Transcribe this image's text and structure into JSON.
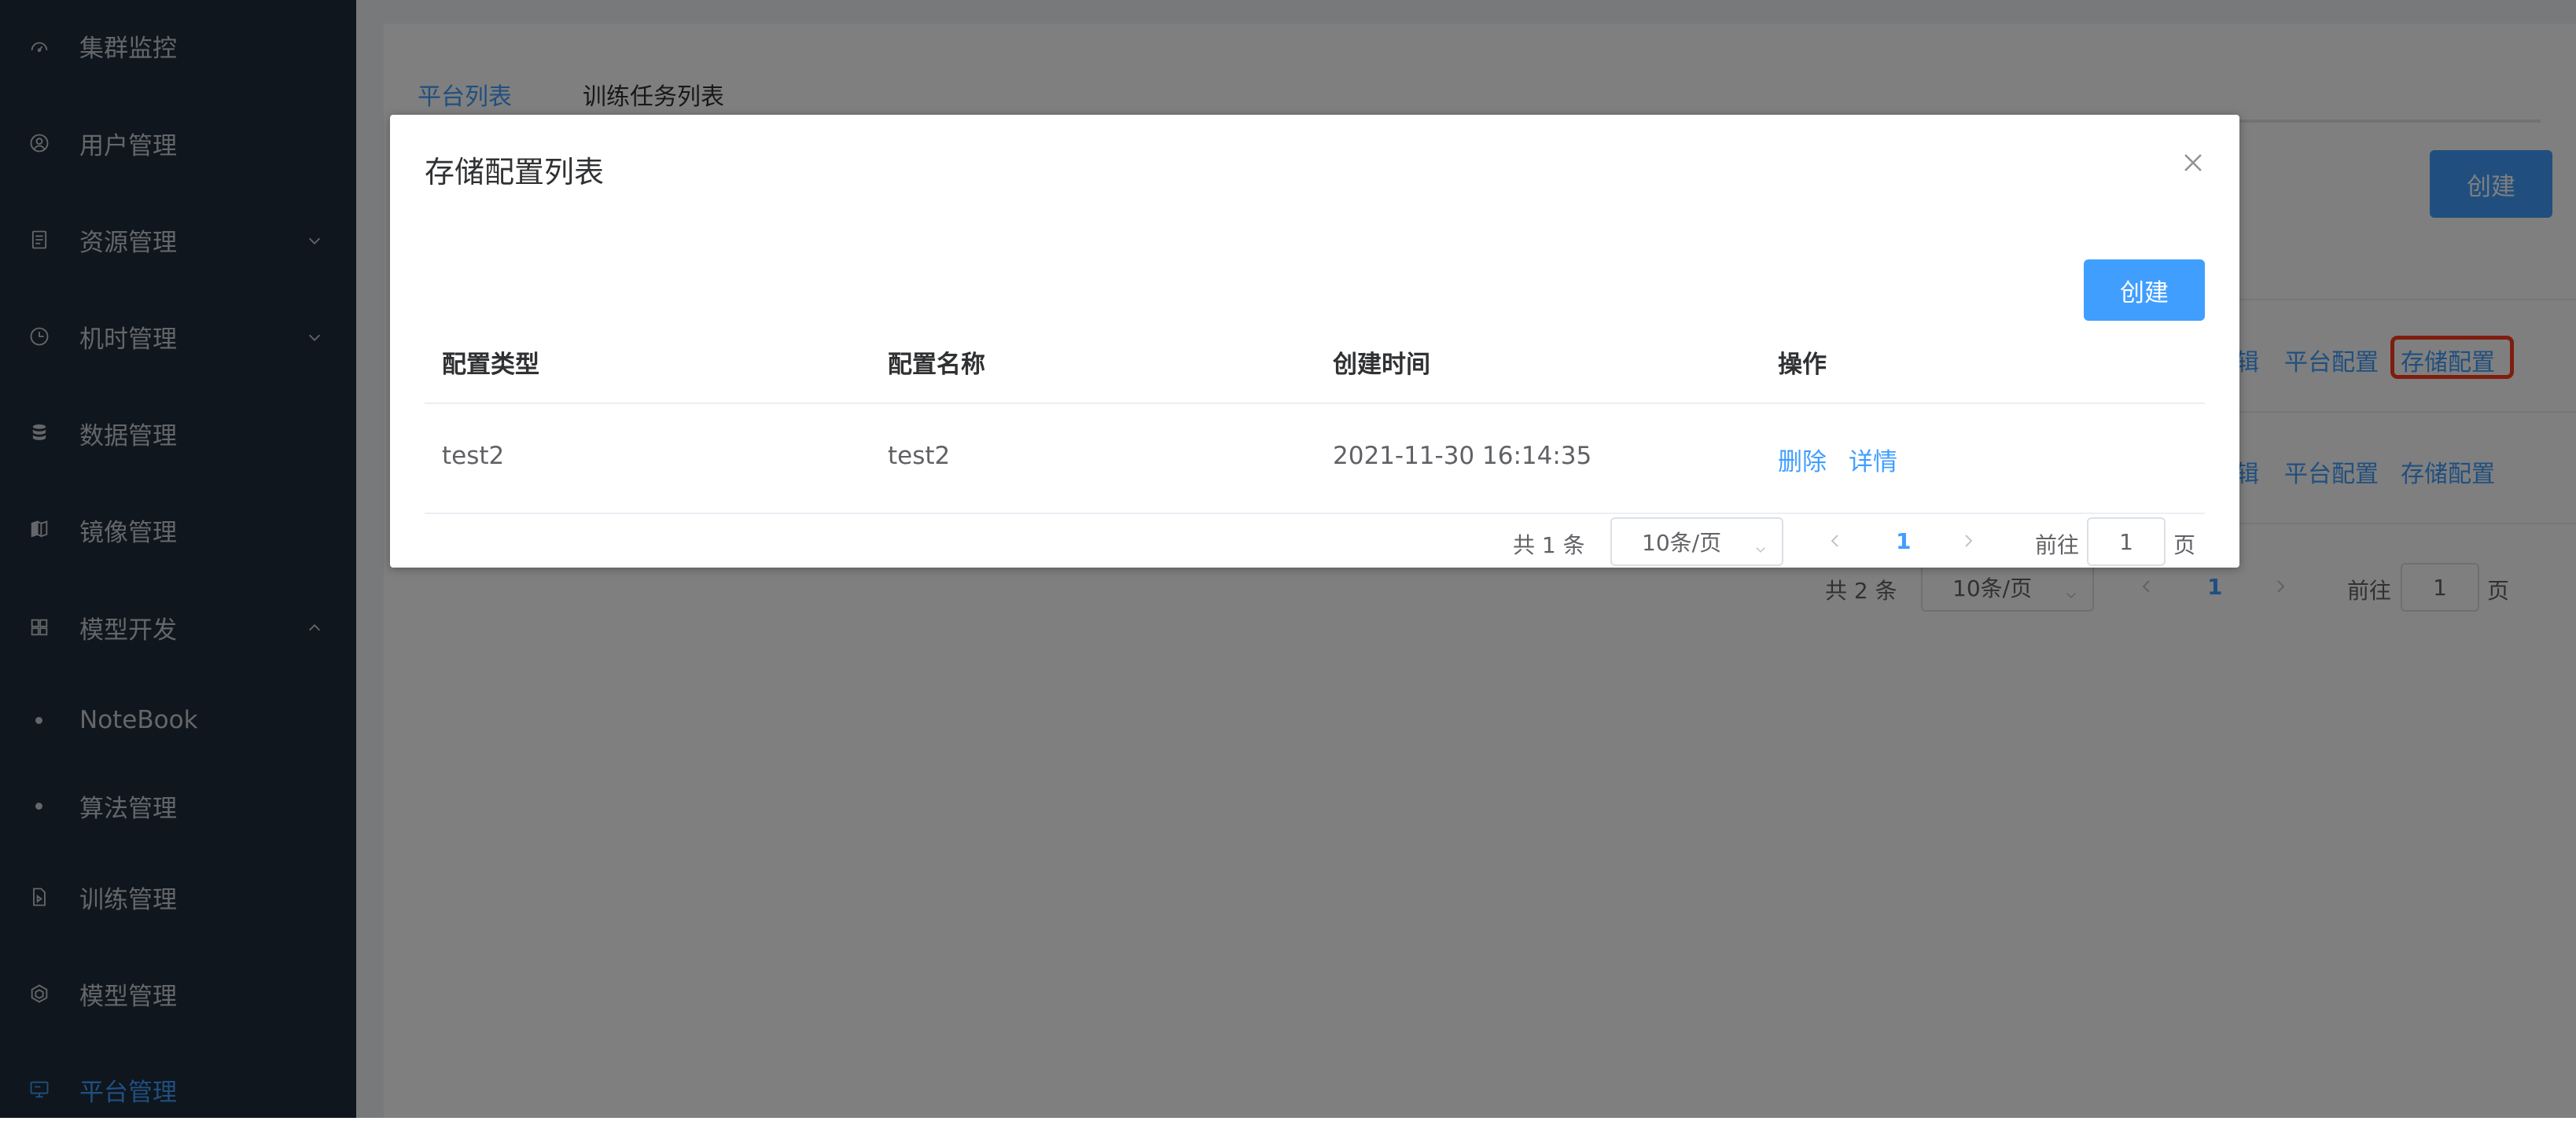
{
  "sidebar": {
    "items": [
      {
        "label": "集群监控",
        "icon": "dashboard-icon"
      },
      {
        "label": "用户管理",
        "icon": "user-icon"
      },
      {
        "label": "资源管理",
        "icon": "document-icon"
      },
      {
        "label": "机时管理",
        "icon": "clock-icon"
      },
      {
        "label": "数据管理",
        "icon": "database-icon"
      },
      {
        "label": "镜像管理",
        "icon": "image-icon"
      },
      {
        "label": "模型开发",
        "icon": "grid-icon"
      },
      {
        "label": "NoteBook"
      },
      {
        "label": "算法管理"
      },
      {
        "label": "训练管理",
        "icon": "file-icon"
      },
      {
        "label": "模型管理",
        "icon": "cube-icon"
      },
      {
        "label": "平台管理",
        "icon": "monitor-icon"
      }
    ]
  },
  "main": {
    "tabs": [
      {
        "label": "平台列表",
        "active": true
      },
      {
        "label": "训练任务列表",
        "active": false
      }
    ],
    "create_label": "创建",
    "row_actions": [
      {
        "edit": "辑",
        "platform_config": "平台配置",
        "storage_config": "存储配置"
      },
      {
        "edit": "辑",
        "platform_config": "平台配置",
        "storage_config": "存储配置"
      }
    ],
    "pager": {
      "total": "共 2 条",
      "page_size": "10条/页",
      "current_page": "1",
      "goto_label": "前往",
      "goto_value": "1",
      "page_suffix": "页"
    }
  },
  "dialog": {
    "title": "存储配置列表",
    "create_label": "创建",
    "columns": [
      "配置类型",
      "配置名称",
      "创建时间",
      "操作"
    ],
    "rows": [
      {
        "type": "test2",
        "name": "test2",
        "created": "2021-11-30 16:14:35",
        "delete": "删除",
        "detail": "详情"
      }
    ],
    "pager": {
      "total": "共 1 条",
      "page_size": "10条/页",
      "current_page": "1",
      "goto_label": "前往",
      "goto_value": "1",
      "page_suffix": "页"
    }
  },
  "colors": {
    "sidebar_bg": "#1f2d3d",
    "accent": "#409eff",
    "highlight_box": "#ff3b1f"
  }
}
